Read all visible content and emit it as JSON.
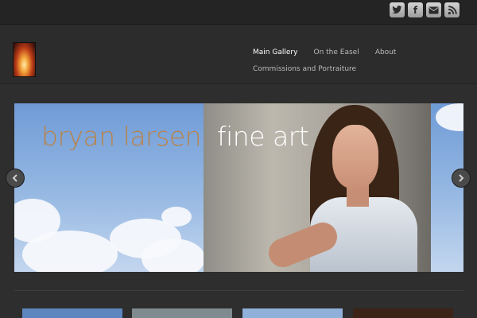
{
  "social": {
    "twitter_icon": "twitter-icon",
    "facebook_glyph": "f",
    "email_icon": "email-icon",
    "rss_icon": "rss-icon"
  },
  "nav": {
    "items": [
      {
        "label": "Main Gallery",
        "active": true
      },
      {
        "label": "On the Easel",
        "active": false
      },
      {
        "label": "About",
        "active": false
      },
      {
        "label": "Commissions and Portraiture",
        "active": false
      }
    ]
  },
  "hero": {
    "title_part1": "bryan larsen",
    "title_part2": "fine art"
  },
  "colors": {
    "background": "#2e2e2e",
    "topbar": "#242424",
    "title_gold": "#b9834a",
    "nav_active": "#ffffff",
    "nav_inactive": "#b9b9b9"
  },
  "thumbnails": [
    {
      "name": "thumbnail-1",
      "color": "#5d86be"
    },
    {
      "name": "thumbnail-2",
      "color": "#7f8b8f"
    },
    {
      "name": "thumbnail-3",
      "color": "#8fb0d8"
    },
    {
      "name": "thumbnail-4",
      "color": "#3b2417"
    }
  ]
}
